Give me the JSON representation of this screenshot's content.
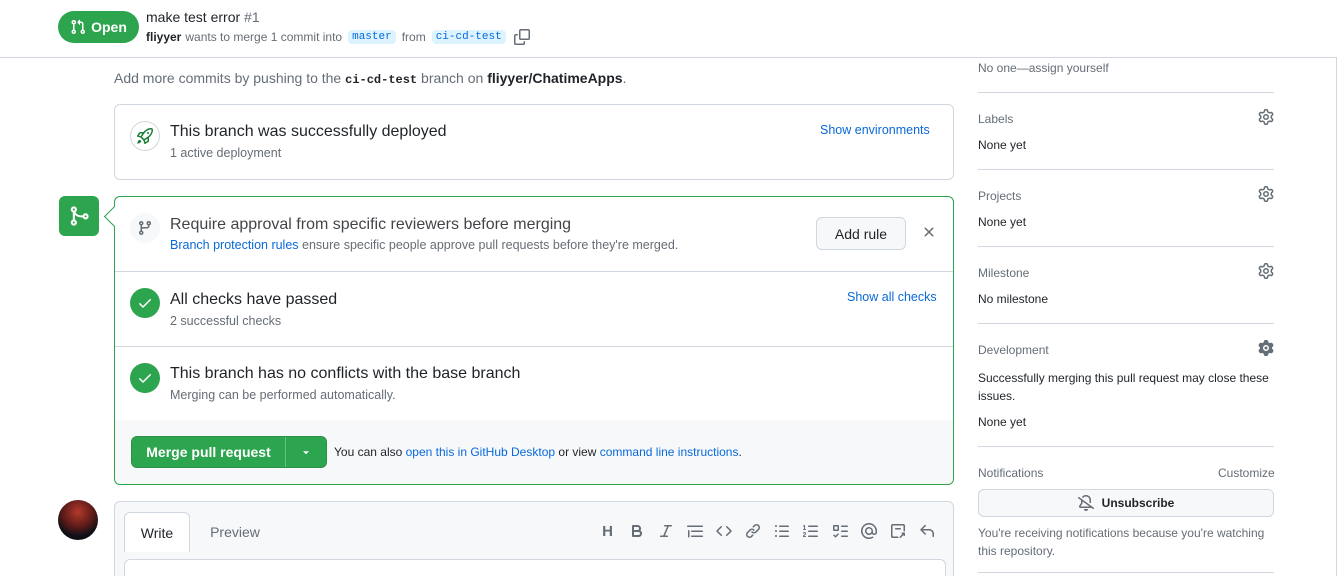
{
  "header": {
    "state": "Open",
    "title": "make test error",
    "number": "#1",
    "author": "fliyyer",
    "meta_middle": "wants to merge 1 commit into",
    "base_branch": "master",
    "meta_from": "from",
    "head_branch": "ci-cd-test"
  },
  "hint": {
    "prefix": "Add more commits by pushing to the",
    "branch": "ci-cd-test",
    "middle": "branch on",
    "repo": "fliyyer/ChatimeApps",
    "suffix": "."
  },
  "deploy": {
    "title": "This branch was successfully deployed",
    "subtitle": "1 active deployment",
    "link": "Show environments"
  },
  "merge_box": {
    "protection": {
      "title": "Require approval from specific reviewers before merging",
      "link": "Branch protection rules",
      "text": "ensure specific people approve pull requests before they're merged.",
      "button": "Add rule"
    },
    "checks": {
      "title": "All checks have passed",
      "subtitle": "2 successful checks",
      "link": "Show all checks"
    },
    "conflicts": {
      "title": "This branch has no conflicts with the base branch",
      "subtitle": "Merging can be performed automatically."
    },
    "footer": {
      "merge_button": "Merge pull request",
      "text_prefix": "You can also",
      "link1": "open this in GitHub Desktop",
      "text_middle": "or view",
      "link2": "command line instructions",
      "text_suffix": "."
    }
  },
  "comment": {
    "tab_write": "Write",
    "tab_preview": "Preview",
    "toolbar": [
      "heading",
      "bold",
      "italic",
      "quote",
      "code",
      "link",
      "unordered-list",
      "ordered-list",
      "task-list",
      "mention",
      "reference",
      "reply"
    ],
    "heading_glyph": "H"
  },
  "sidebar": {
    "assignees_value": "No one—assign yourself",
    "labels": {
      "heading": "Labels",
      "value": "None yet"
    },
    "projects": {
      "heading": "Projects",
      "value": "None yet"
    },
    "milestone": {
      "heading": "Milestone",
      "value": "No milestone"
    },
    "development": {
      "heading": "Development",
      "text_line1": "Successfully merging this pull request may close these",
      "text_line2": "issues.",
      "value": "None yet"
    },
    "notifications": {
      "heading": "Notifications",
      "customize": "Customize",
      "button": "Unsubscribe",
      "text_line1": "You're receiving notifications because you're watching",
      "text_line2": "this repository."
    }
  },
  "colors": {
    "success": "#2da44e",
    "link": "#0969da",
    "border": "#d0d7de",
    "muted": "#656d76"
  }
}
